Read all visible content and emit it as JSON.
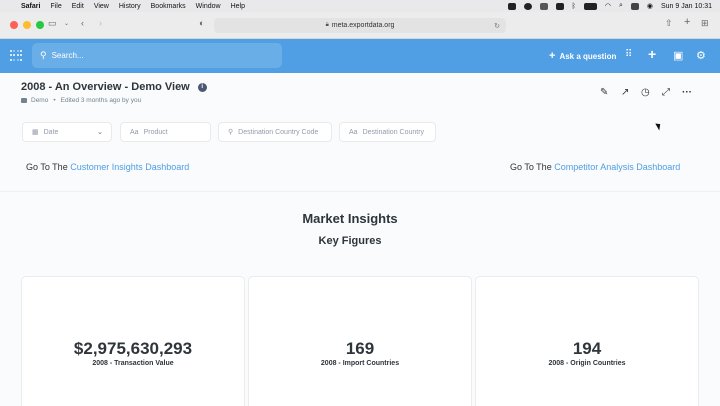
{
  "menubar": {
    "apple": "",
    "items": [
      "Safari",
      "File",
      "Edit",
      "View",
      "History",
      "Bookmarks",
      "Window",
      "Help"
    ],
    "clock": "Sun 9 Jan  10:31"
  },
  "browser": {
    "url": "meta.exportdata.org"
  },
  "appbar": {
    "search_placeholder": "Search...",
    "ask_label": "Ask a question"
  },
  "dashboard": {
    "title": "2008 - An Overview - Demo View",
    "collection": "Demo",
    "edited": "Edited 3 months ago by you"
  },
  "filters": [
    {
      "label": "Date",
      "icon": "calendar-icon"
    },
    {
      "label": "Product",
      "icon": "text-aa-icon"
    },
    {
      "label": "Destination Country Code",
      "icon": "location-pin-icon"
    },
    {
      "label": "Destination Country",
      "icon": "text-aa-icon"
    }
  ],
  "links": {
    "left_prefix": "Go To The",
    "left_link": "Customer Insights Dashboard",
    "right_prefix": "Go To The",
    "right_link": "Competitor Analysis Dashboard"
  },
  "section": {
    "title": "Market Insights",
    "subtitle": "Key Figures"
  },
  "cards": [
    {
      "value": "$2,975,630,293",
      "label": "2008 - Transaction Value"
    },
    {
      "value": "169",
      "label": "2008 - Import Countries"
    },
    {
      "value": "194",
      "label": "2008 - Origin Countries"
    }
  ],
  "colors": {
    "brand": "#509ee3",
    "text": "#2e353b",
    "muted": "#74838f"
  }
}
